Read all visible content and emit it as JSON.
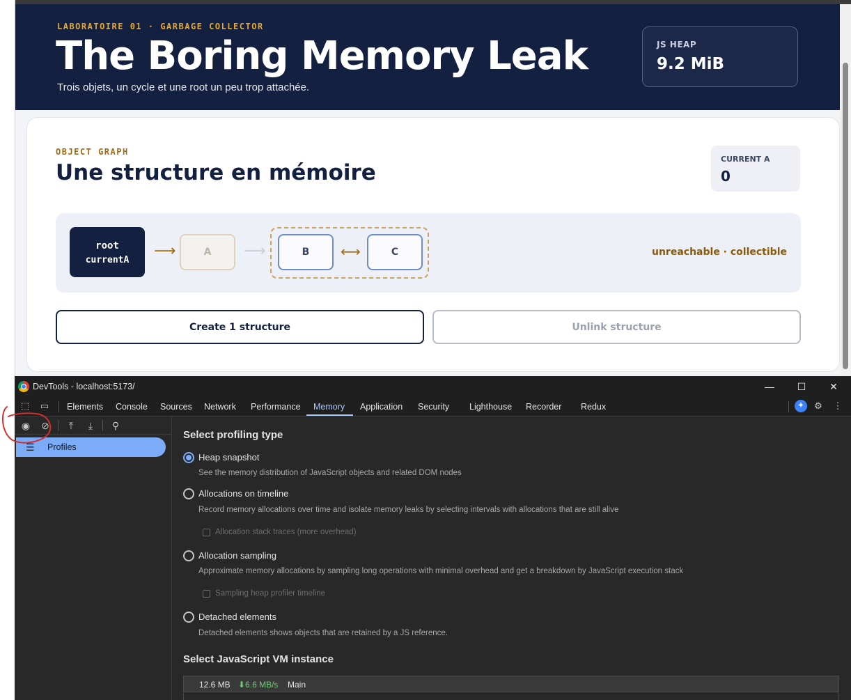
{
  "hero": {
    "kicker": "LABORATOIRE 01 · GARBAGE COLLECTOR",
    "title": "The Boring Memory Leak",
    "subtitle": "Trois objets, un cycle et une root un peu trop attachée.",
    "heap_label": "JS HEAP",
    "heap_value": "9.2 MiB"
  },
  "card": {
    "kicker": "OBJECT GRAPH",
    "title": "Une structure en mémoire",
    "current_label": "CURRENT A",
    "current_value": "0",
    "graph": {
      "root_line1": "root",
      "root_line2": "currentA",
      "node_a": "A",
      "node_b": "B",
      "node_c": "C",
      "status": "unreachable · collectible"
    },
    "buttons": {
      "create": "Create 1 structure",
      "unlink": "Unlink structure"
    }
  },
  "devtools": {
    "title": "DevTools - localhost:5173/",
    "tabs": [
      "Elements",
      "Console",
      "Sources",
      "Network",
      "Performance",
      "Memory",
      "Application",
      "Security",
      "Lighthouse",
      "Recorder",
      "Redux"
    ],
    "active_tab": "Memory",
    "sidebar": {
      "profiles_label": "Profiles"
    },
    "main": {
      "profiling_heading": "Select profiling type",
      "options": [
        {
          "label": "Heap snapshot",
          "desc": "See the memory distribution of JavaScript objects and related DOM nodes",
          "checked": true
        },
        {
          "label": "Allocations on timeline",
          "desc": "Record memory allocations over time and isolate memory leaks by selecting intervals with allocations that are still alive",
          "checked": false
        },
        {
          "label": "Allocation sampling",
          "desc": "Approximate memory allocations by sampling long operations with minimal overhead and get a breakdown by JavaScript execution stack",
          "checked": false
        },
        {
          "label": "Detached elements",
          "desc": "Detached elements shows objects that are retained by a JS reference.",
          "checked": false
        }
      ],
      "checkbox_stack_traces": "Allocation stack traces (more overhead)",
      "checkbox_sampling_timeline": "Sampling heap profiler timeline",
      "vm_heading": "Select JavaScript VM instance",
      "vm": {
        "size": "12.6 MB",
        "rate": "⬇6.6 MB/s",
        "name": "Main"
      }
    }
  },
  "colors": {
    "hero_bg": "#142040",
    "accent_gold": "#e5a92a",
    "devtools_bg": "#282828",
    "devtools_accent": "#7cacf8",
    "annotation": "#d32f2f"
  }
}
